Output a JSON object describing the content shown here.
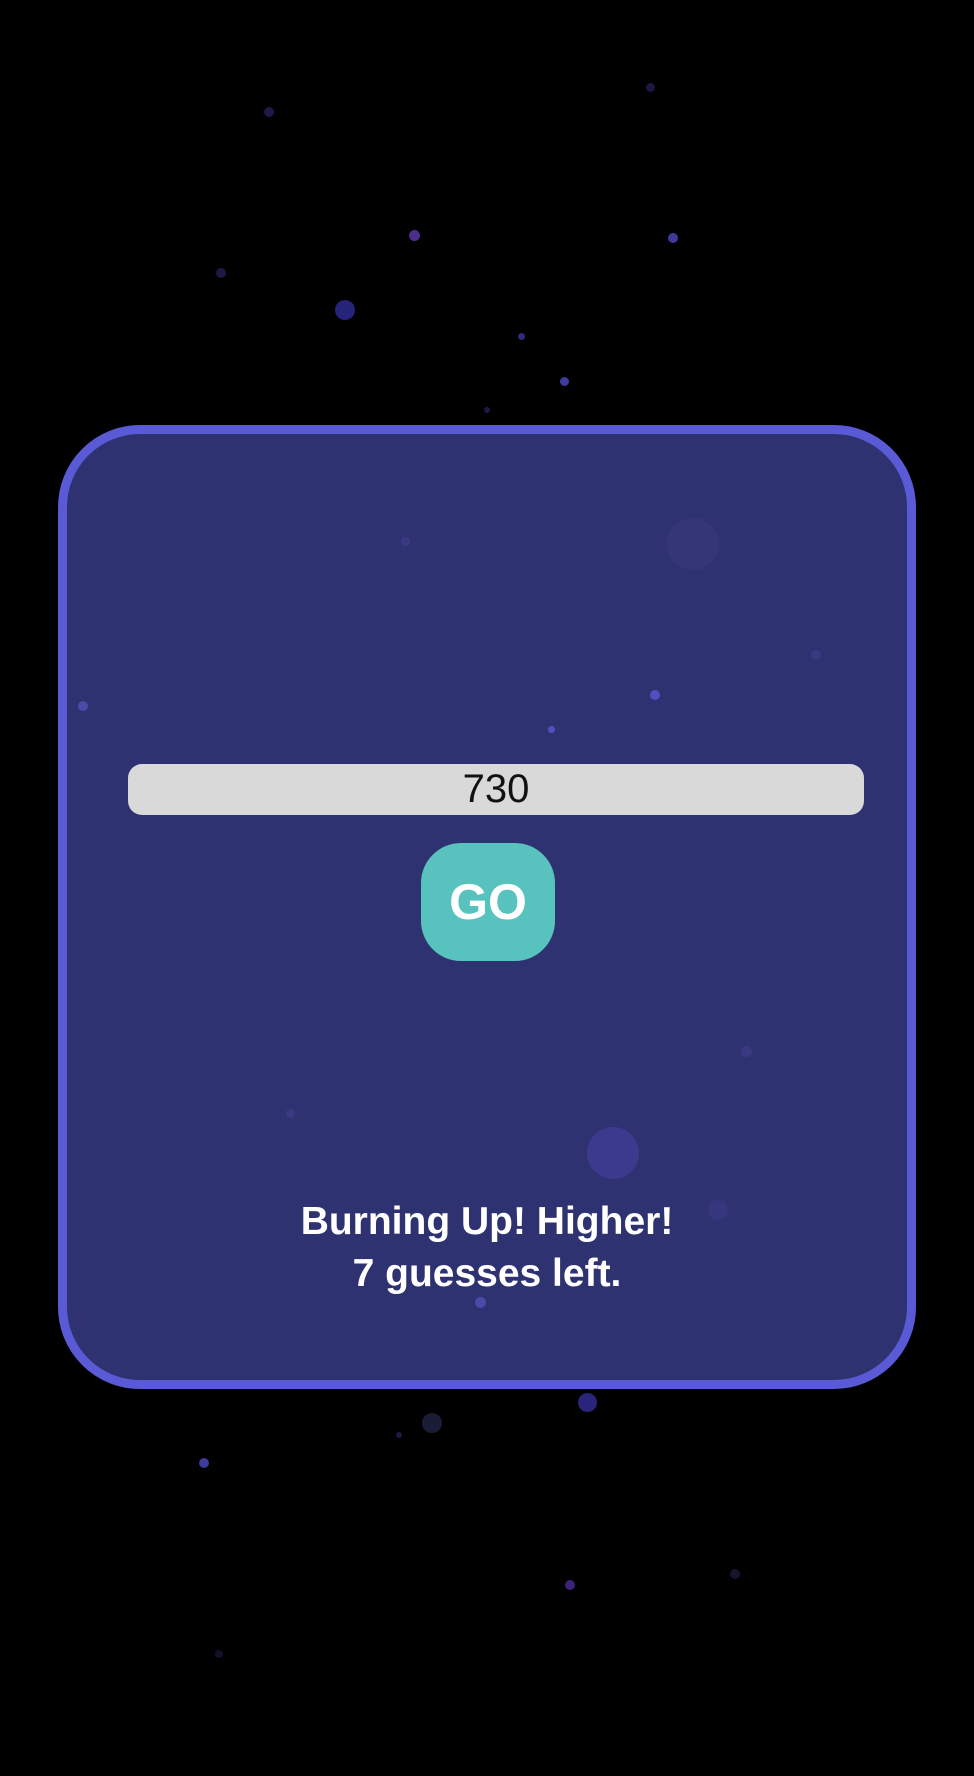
{
  "game": {
    "guess_value": "730",
    "go_label": "GO",
    "feedback_line1": "Burning Up! Higher!",
    "feedback_line2": "7 guesses left."
  },
  "colors": {
    "background": "#000000",
    "card_fill": "#2f3270",
    "card_border": "#5a5ad6",
    "input_fill": "#d9d9d9",
    "button_fill": "#58c3be",
    "text": "#ffffff",
    "particle": "#4a3aa0"
  }
}
